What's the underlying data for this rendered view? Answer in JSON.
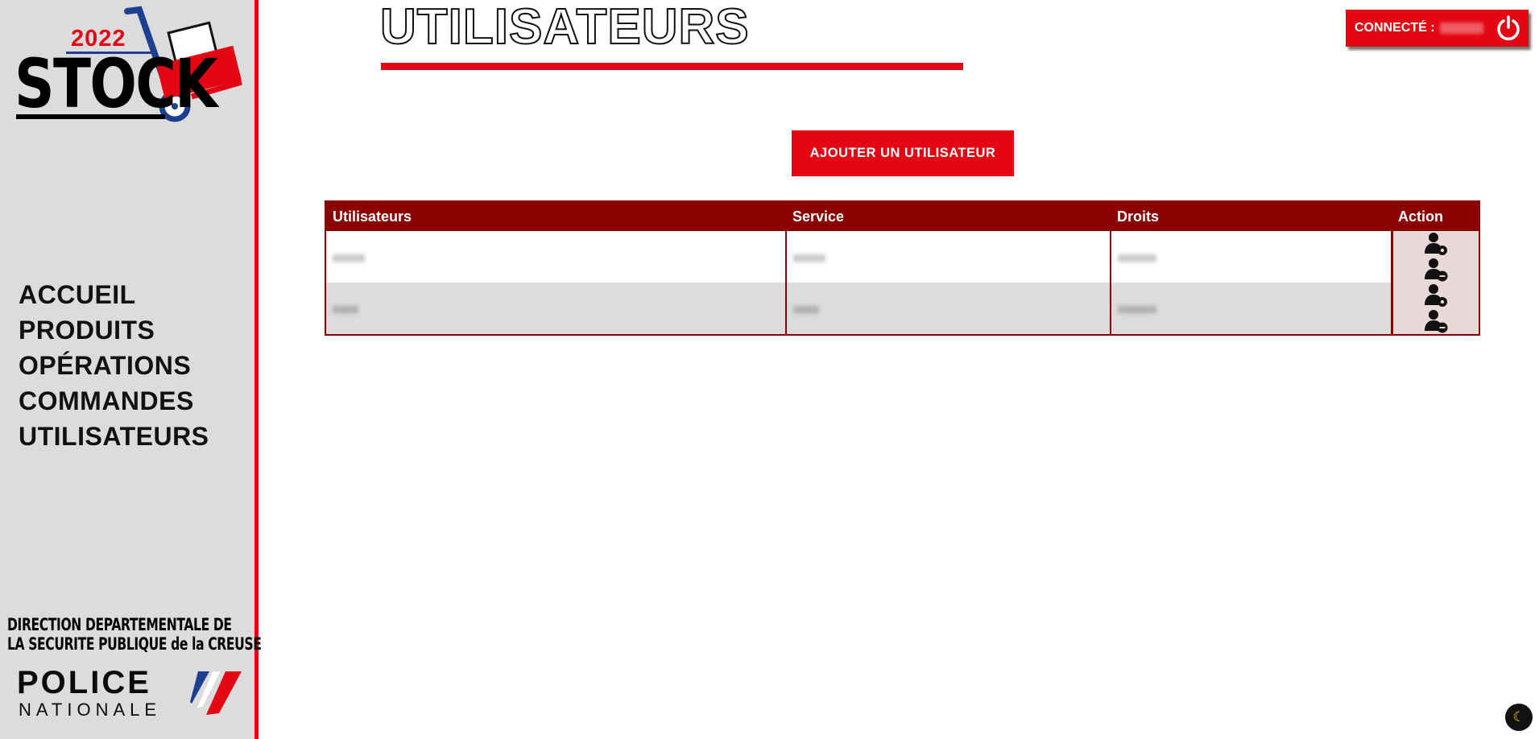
{
  "brand": {
    "logo_year": "2022",
    "logo_word": "STOCK"
  },
  "nav": {
    "items": [
      {
        "label": "ACCUEIL"
      },
      {
        "label": "PRODUITS"
      },
      {
        "label": "OPÉRATIONS"
      },
      {
        "label": "COMMANDES"
      },
      {
        "label": "UTILISATEURS"
      }
    ]
  },
  "footer_branding": {
    "direction_line1": "DIRECTION DEPARTEMENTALE DE",
    "direction_line2": "LA SECURITE PUBLIQUE de la CREUSE",
    "police": "POLICE",
    "nationale": "NATIONALE"
  },
  "header": {
    "title": "UTILISATEURS"
  },
  "session": {
    "label": "CONNECTÉ :",
    "power_icon": "power-icon"
  },
  "actions": {
    "add_user_label": "AJOUTER UN UTILISATEUR"
  },
  "table": {
    "columns": [
      "Utilisateurs",
      "Service",
      "Droits",
      "Action"
    ],
    "rows": [
      {
        "user": "xxxxx",
        "service": "xxxxx",
        "rights": "xxxxxx"
      },
      {
        "user": "xxxx",
        "service": "xxxx",
        "rights": "xxxxxx"
      }
    ],
    "row_icons": [
      "user-settings-icon",
      "user-remove-icon"
    ]
  },
  "colors": {
    "accent": "#e30613",
    "table_header": "#8b0000",
    "sidebar_bg": "#dcdcdc"
  },
  "dark_mode_icon": "moon-icon"
}
